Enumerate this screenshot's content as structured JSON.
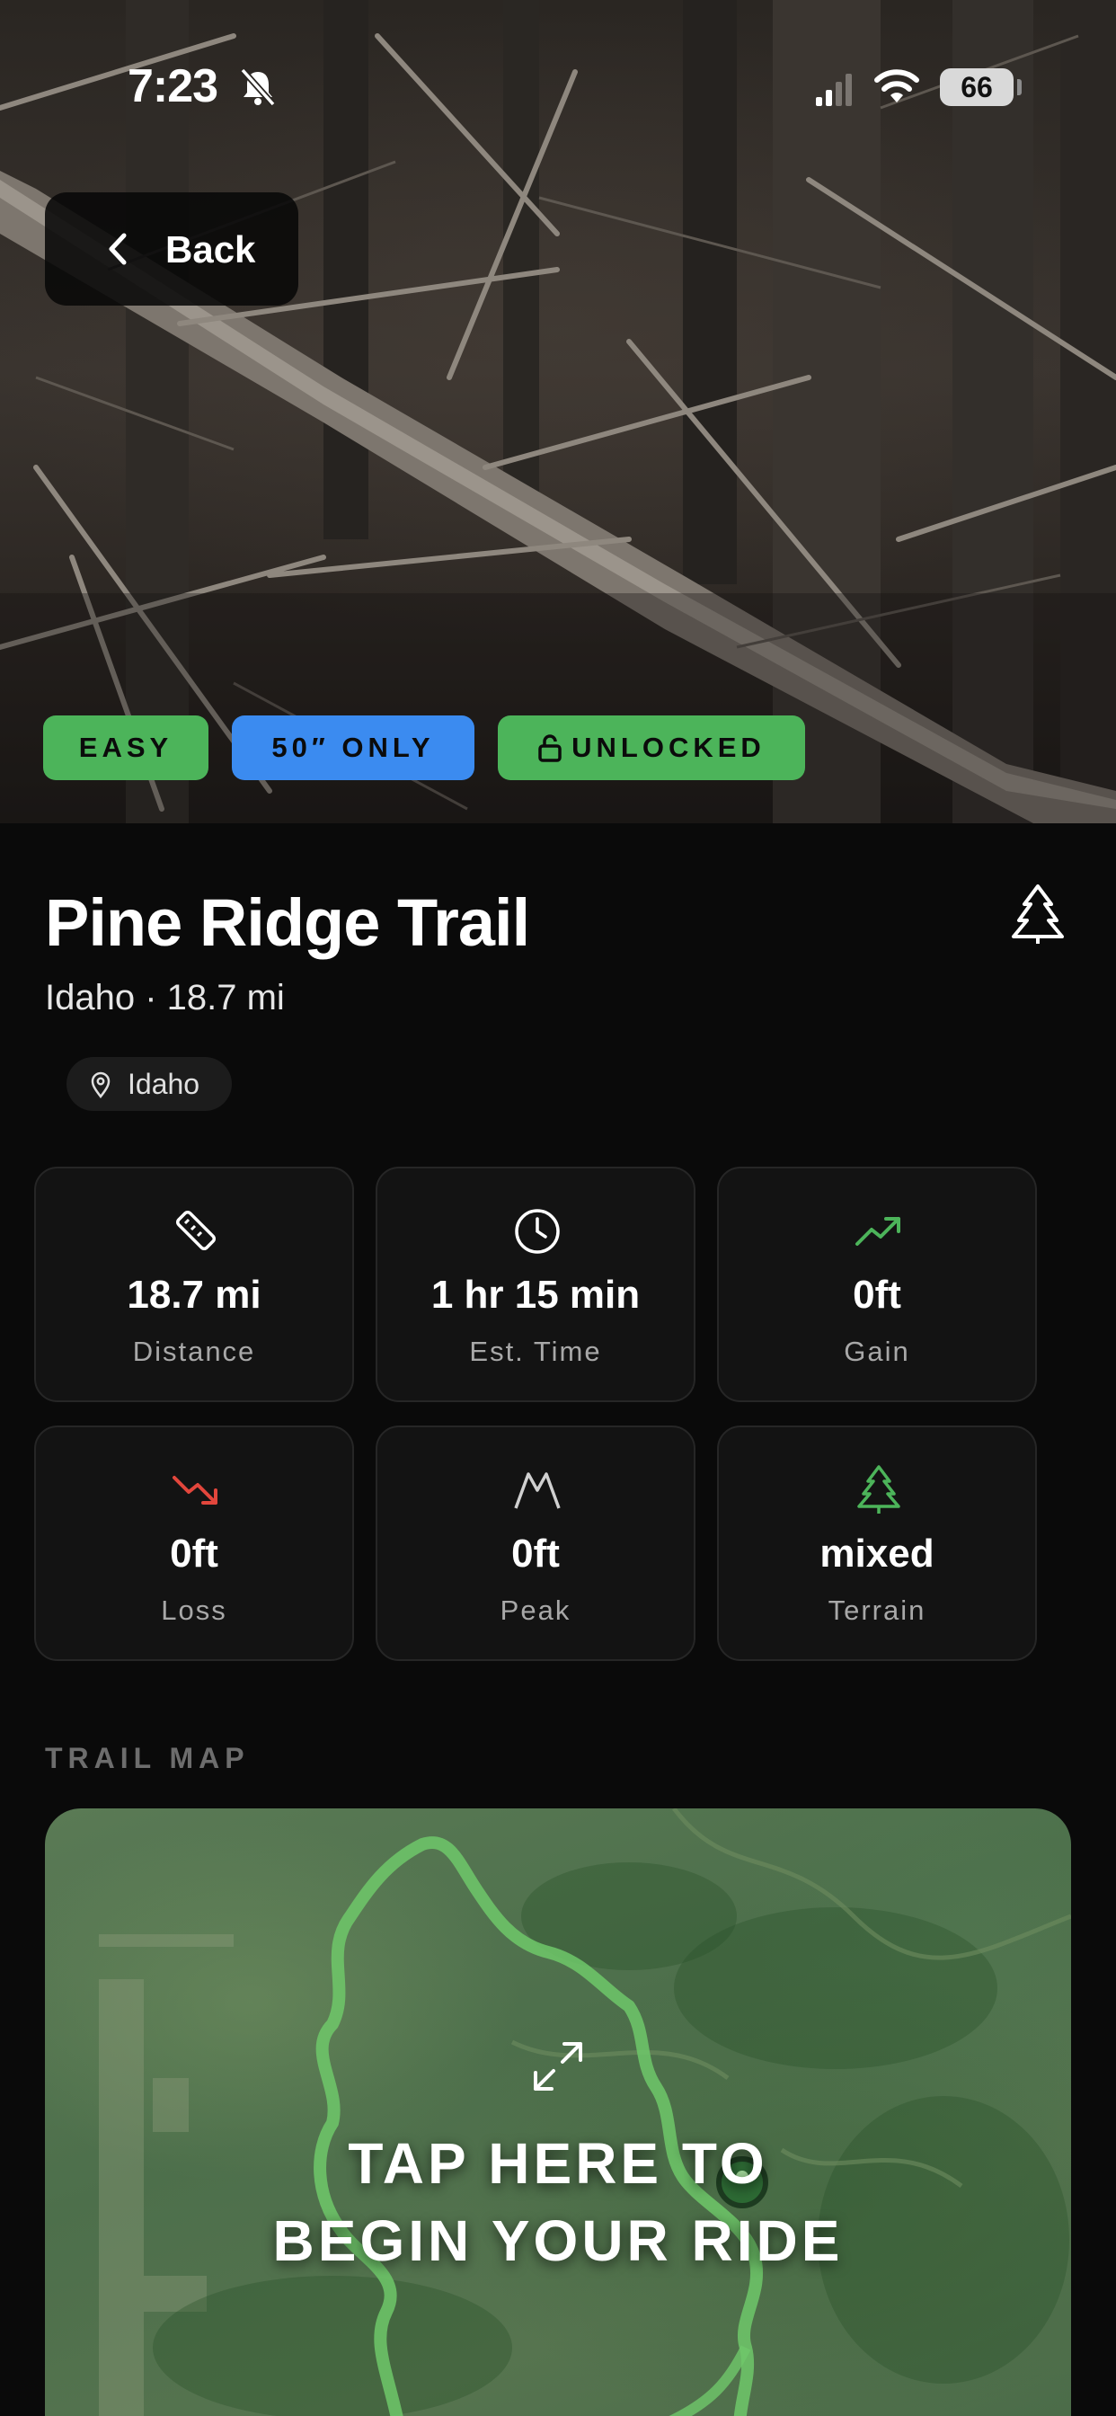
{
  "status_bar": {
    "time": "7:23",
    "battery": "66"
  },
  "nav": {
    "back_label": "Back"
  },
  "badges": {
    "difficulty": "EASY",
    "vehicle_width": "50″ ONLY",
    "access": "UNLOCKED"
  },
  "trail": {
    "title": "Pine Ridge Trail",
    "subtitle": "Idaho · 18.7 mi",
    "location_chip": "Idaho"
  },
  "stats": [
    {
      "icon": "ruler-icon",
      "value": "18.7 mi",
      "label": "Distance",
      "icon_color": "#ffffff"
    },
    {
      "icon": "clock-icon",
      "value": "1 hr 15 min",
      "label": "Est. Time",
      "icon_color": "#ffffff"
    },
    {
      "icon": "trending-up-icon",
      "value": "0ft",
      "label": "Gain",
      "icon_color": "#4cb45a"
    },
    {
      "icon": "trending-down-icon",
      "value": "0ft",
      "label": "Loss",
      "icon_color": "#e2463c"
    },
    {
      "icon": "mountain-icon",
      "value": "0ft",
      "label": "Peak",
      "icon_color": "#d0d0d0"
    },
    {
      "icon": "tree-icon",
      "value": "mixed",
      "label": "Terrain",
      "icon_color": "#4cb45a"
    }
  ],
  "map": {
    "section_label": "TRAIL MAP",
    "cta_line1": "TAP HERE TO",
    "cta_line2": "BEGIN YOUR RIDE",
    "route_color": "#6fc86a"
  },
  "colors": {
    "easy_green": "#4cb45a",
    "size_blue": "#3b8bf0",
    "background": "#0a0a0a",
    "card": "#131313"
  }
}
